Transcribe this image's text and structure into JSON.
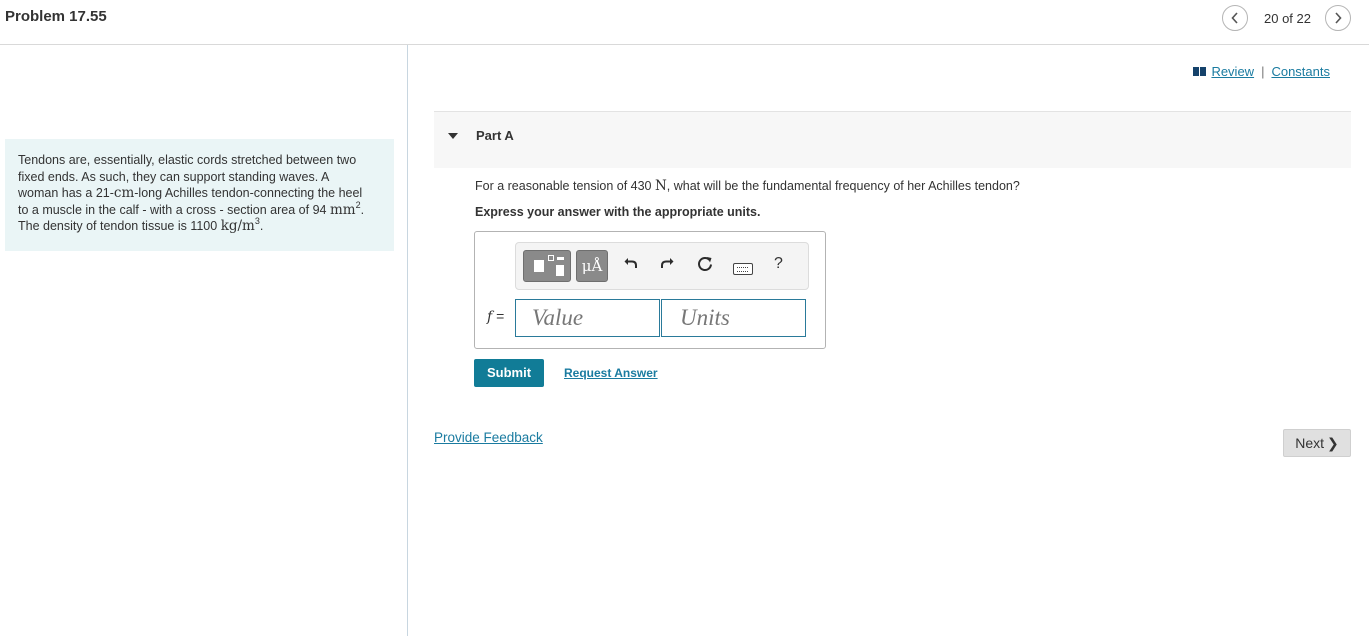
{
  "header": {
    "problem_title": "Problem 17.55",
    "pager_text": "20 of 22",
    "prev_icon": "chevron-left-icon",
    "next_icon": "chevron-right-icon"
  },
  "intro": {
    "line1": "Tendons are, essentially, elastic cords stretched between two",
    "line2": "fixed ends. As such, they can support standing waves. A",
    "line3_pre": "woman has a 21-",
    "line3_unit": "cm",
    "line3_post": "-long Achilles tendon-connecting the heel",
    "line4_pre": "to a muscle in the calf - with a cross - section area of 94 ",
    "line4_unit": "mm",
    "line4_exp": "2",
    "line4_post": ".",
    "line5_pre": "The density of tendon tissue is 1100 ",
    "line5_unit": "kg/m",
    "line5_exp": "3",
    "line5_post": "."
  },
  "links": {
    "review": "Review",
    "separator": "|",
    "constants": "Constants"
  },
  "part": {
    "label": "Part A",
    "question_pre": "For a reasonable tension of 430 ",
    "question_unit": "N",
    "question_post": ", what will be the fundamental frequency of her Achilles tendon?",
    "instruction": "Express your answer with the appropriate units."
  },
  "toolbar": {
    "units_label": "μÅ",
    "undo_icon": "undo-icon",
    "redo_icon": "redo-icon",
    "reset_icon": "reset-icon",
    "keyboard_icon": "keyboard-icon",
    "help_label": "?"
  },
  "answer": {
    "variable": "f",
    "equals": "=",
    "value_placeholder": "Value",
    "units_placeholder": "Units"
  },
  "actions": {
    "submit_label": "Submit",
    "request_answer_label": "Request Answer",
    "feedback_label": "Provide Feedback",
    "next_label": "Next"
  },
  "colors": {
    "accent": "#117c97",
    "link": "#1a7ba0",
    "intro_bg": "#eaf5f6"
  }
}
